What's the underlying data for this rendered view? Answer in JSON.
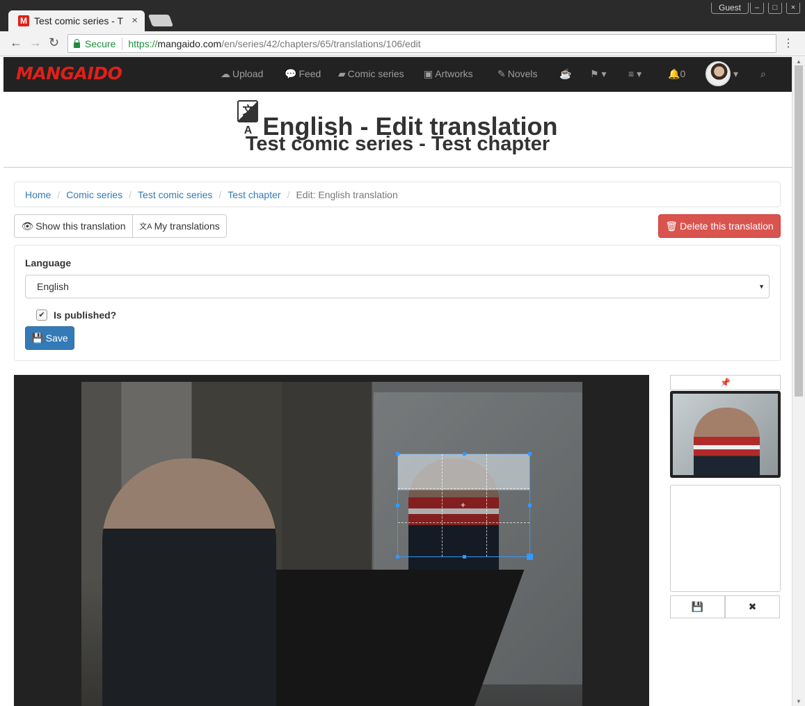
{
  "browser": {
    "tab_title": "Test comic series - T",
    "tab_favicon": "M",
    "tab_close": "×",
    "guest_label": "Guest",
    "url_secure": "Secure",
    "url_https": "https://",
    "url_host": "mangaido.com",
    "url_path": "/en/series/42/chapters/65/translations/106/edit",
    "icons": [
      "back-arrow-icon",
      "forward-arrow-icon",
      "reload-icon",
      "lock-icon",
      "menu-kebab-icon"
    ]
  },
  "navbar": {
    "brand": "MANGAIDO",
    "items": [
      {
        "icon": "cloud-upload-icon",
        "label": "Upload"
      },
      {
        "icon": "comments-icon",
        "label": "Feed"
      },
      {
        "icon": "book-icon",
        "label": "Comic series"
      },
      {
        "icon": "picture-icon",
        "label": "Artworks"
      },
      {
        "icon": "edit-icon",
        "label": "Novels"
      }
    ],
    "notification_count": "0",
    "icons": [
      "tea-icon",
      "flag-icon",
      "menu-icon",
      "bell-icon",
      "avatar",
      "search-icon"
    ]
  },
  "header": {
    "title": "English - Edit translation",
    "subtitle": "Test comic series - Test chapter"
  },
  "breadcrumb": {
    "items": [
      "Home",
      "Comic series",
      "Test comic series",
      "Test chapter"
    ],
    "active": "Edit: English translation"
  },
  "actions": {
    "show_translation": "Show this translation",
    "my_translations": "My translations",
    "delete_translation": "Delete this translation"
  },
  "form": {
    "language_label": "Language",
    "language_value": "English",
    "published_label": "Is published?",
    "published_checked": true,
    "save_label": "Save"
  },
  "colors": {
    "navbar_bg": "#222222",
    "brand_red": "#e0201a",
    "link_blue": "#337ab7",
    "danger_red": "#d9534f",
    "primary_blue": "#337ab7",
    "crop_blue": "#3399ff"
  }
}
